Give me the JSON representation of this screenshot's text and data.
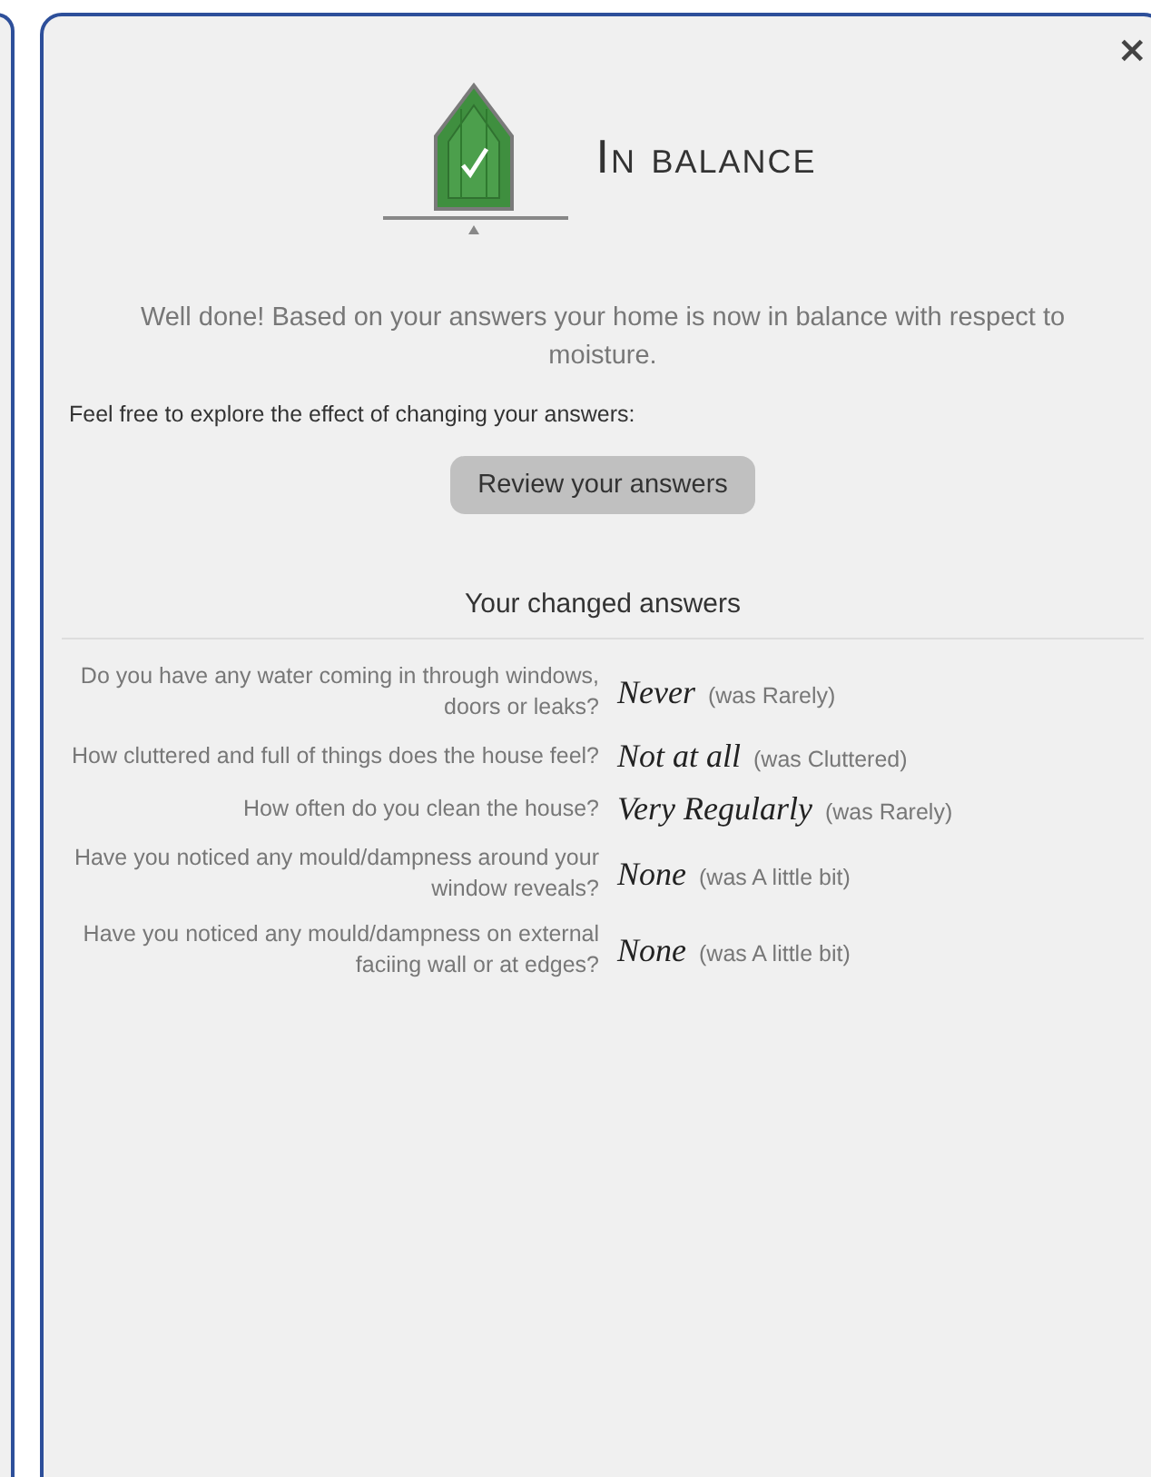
{
  "dialog": {
    "title": "In balance",
    "close": "×",
    "message": "Well done! Based on your answers your home is now in balance with respect to moisture.",
    "prompt": "Feel free to explore the effect of changing your answers:",
    "review_button": "Review your answers",
    "section_heading": "Your changed answers",
    "answers": [
      {
        "question": "Do you have any water coming in through windows, doors or leaks?",
        "answer": "Never",
        "previous": "(was Rarely)"
      },
      {
        "question": "How cluttered and full of things does the house feel?",
        "answer": "Not at all",
        "previous": "(was Cluttered)"
      },
      {
        "question": "How often do you clean the house?",
        "answer": "Very Regularly",
        "previous": "(was Rarely)"
      },
      {
        "question": "Have you noticed any mould/dampness around your window reveals?",
        "answer": "None",
        "previous": "(was A little bit)"
      },
      {
        "question": "Have you noticed any mould/dampness on external faciing wall or at edges?",
        "answer": "None",
        "previous": "(was A little bit)"
      }
    ]
  }
}
